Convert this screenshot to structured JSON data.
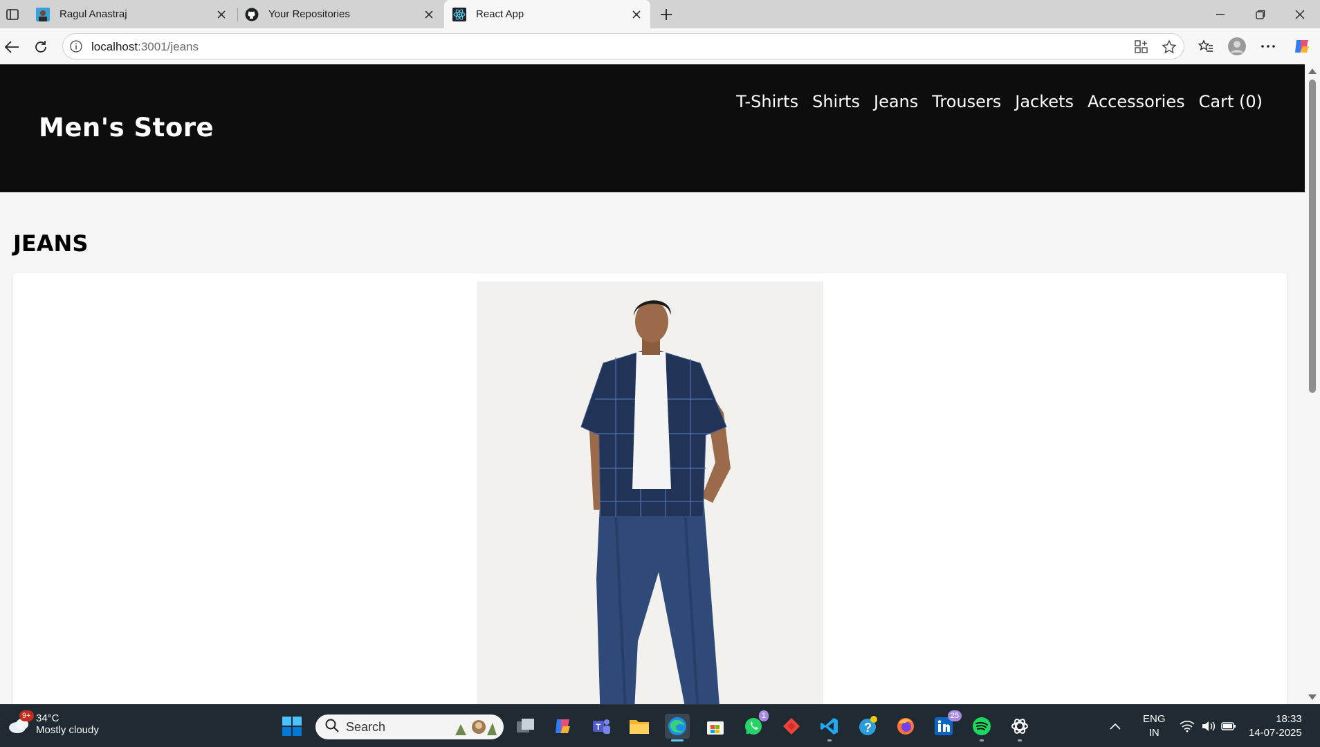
{
  "browser": {
    "tabs": [
      {
        "title": "Ragul Anastraj",
        "icon": "profile-favicon"
      },
      {
        "title": "Your Repositories",
        "icon": "github-icon"
      },
      {
        "title": "React App",
        "icon": "react-icon",
        "active": true
      }
    ],
    "url_host": "localhost",
    "url_path": ":3001/jeans"
  },
  "site": {
    "brand": "Men's Store",
    "nav": [
      "T-Shirts",
      "Shirts",
      "Jeans",
      "Trousers",
      "Jackets",
      "Accessories",
      "Cart (0)"
    ],
    "page_title": "JEANS",
    "product_image": "model-in-checked-shirt-and-blue-jeans"
  },
  "taskbar": {
    "weather_badge": "9+",
    "temperature": "34°C",
    "weather_condition": "Mostly cloudy",
    "search_placeholder": "Search",
    "whatsapp_badge": "1",
    "linkedin_badge": "25",
    "language_line1": "ENG",
    "language_line2": "IN",
    "time": "18:33",
    "date": "14-07-2025"
  },
  "colors": {
    "header_bg": "#0d0d0d",
    "page_bg": "#f5f5f5",
    "taskbar_bg": "#1f2a33",
    "accent": "#60cdff"
  }
}
